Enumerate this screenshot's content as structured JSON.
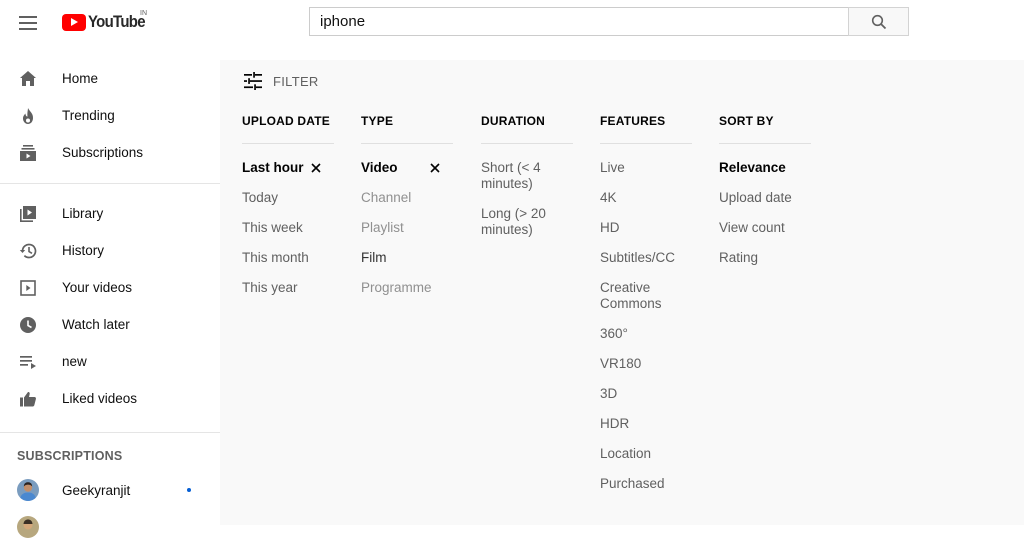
{
  "header": {
    "logo_text": "YouTube",
    "country_code": "IN",
    "search_value": "iphone",
    "icons": {
      "menu": "hamburger-menu-icon",
      "search": "search-icon"
    }
  },
  "sidebar": {
    "main_items": [
      {
        "label": "Home",
        "icon": "home-icon"
      },
      {
        "label": "Trending",
        "icon": "flame-icon"
      },
      {
        "label": "Subscriptions",
        "icon": "subscriptions-icon"
      }
    ],
    "library_items": [
      {
        "label": "Library",
        "icon": "library-icon"
      },
      {
        "label": "History",
        "icon": "history-icon"
      },
      {
        "label": "Your videos",
        "icon": "your-videos-icon"
      },
      {
        "label": "Watch later",
        "icon": "clock-icon"
      },
      {
        "label": "new",
        "icon": "playlist-icon"
      },
      {
        "label": "Liked videos",
        "icon": "thumbs-up-icon"
      }
    ],
    "subscriptions_heading": "SUBSCRIPTIONS",
    "subscriptions": [
      {
        "label": "Geekyranjit",
        "has_new": true,
        "avatar_color": "#5b8fc7"
      }
    ]
  },
  "filter": {
    "toggle_label": "FILTER",
    "columns": [
      {
        "heading": "UPLOAD DATE",
        "options": [
          {
            "label": "Last hour",
            "state": "selected"
          },
          {
            "label": "Today",
            "state": "normal"
          },
          {
            "label": "This week",
            "state": "normal"
          },
          {
            "label": "This month",
            "state": "normal"
          },
          {
            "label": "This year",
            "state": "normal"
          }
        ]
      },
      {
        "heading": "TYPE",
        "options": [
          {
            "label": "Video",
            "state": "selected"
          },
          {
            "label": "Channel",
            "state": "disabled"
          },
          {
            "label": "Playlist",
            "state": "disabled"
          },
          {
            "label": "Film",
            "state": "normal"
          },
          {
            "label": "Programme",
            "state": "disabled"
          }
        ]
      },
      {
        "heading": "DURATION",
        "options": [
          {
            "label": "Short (< 4 minutes)",
            "state": "normal"
          },
          {
            "label": "Long (> 20 minutes)",
            "state": "normal"
          }
        ]
      },
      {
        "heading": "FEATURES",
        "options": [
          {
            "label": "Live",
            "state": "normal"
          },
          {
            "label": "4K",
            "state": "normal"
          },
          {
            "label": "HD",
            "state": "normal"
          },
          {
            "label": "Subtitles/CC",
            "state": "normal"
          },
          {
            "label": "Creative Commons",
            "state": "normal"
          },
          {
            "label": "360°",
            "state": "normal"
          },
          {
            "label": "VR180",
            "state": "normal"
          },
          {
            "label": "3D",
            "state": "normal"
          },
          {
            "label": "HDR",
            "state": "normal"
          },
          {
            "label": "Location",
            "state": "normal"
          },
          {
            "label": "Purchased",
            "state": "normal"
          }
        ]
      },
      {
        "heading": "SORT BY",
        "options": [
          {
            "label": "Relevance",
            "state": "selected"
          },
          {
            "label": "Upload date",
            "state": "normal"
          },
          {
            "label": "View count",
            "state": "normal"
          },
          {
            "label": "Rating",
            "state": "normal"
          }
        ]
      }
    ]
  },
  "colors": {
    "brand_red": "#ff0000",
    "panel_bg": "#f9f9f9",
    "new_dot": "#065fd4"
  }
}
